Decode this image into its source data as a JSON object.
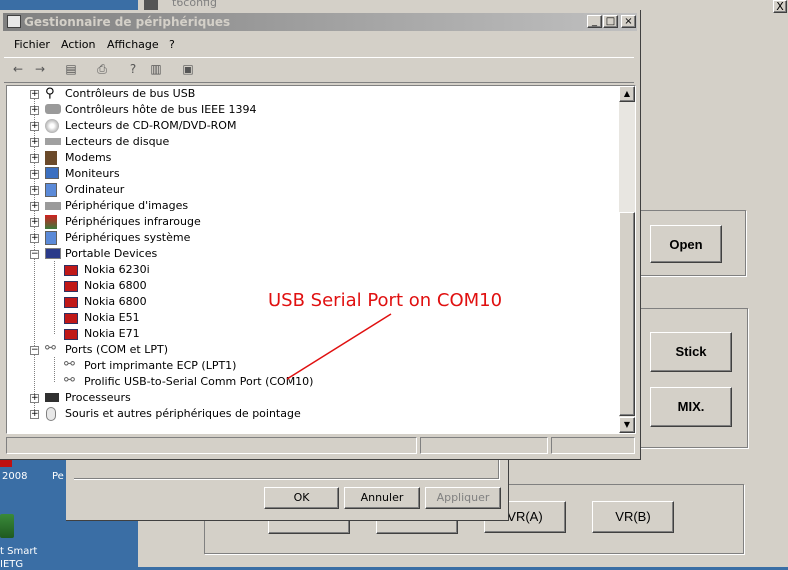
{
  "desktop": {
    "text_2008": "2008",
    "text_pe": "Pe",
    "text_smart": "t Smart",
    "text_ietg": "IETG"
  },
  "background_window": {
    "title": "t6config",
    "close_label": "X",
    "open_button": "Open",
    "stick_button": "Stick",
    "mix_button": "MIX.",
    "vra_button": "VR(A)",
    "vrb_button": "VR(B)"
  },
  "dialog": {
    "ok_label": "OK",
    "cancel_label": "Annuler",
    "apply_label": "Appliquer"
  },
  "window": {
    "title": "Gestionnaire de périphériques",
    "minimize": "_",
    "maximize": "□",
    "close": "×",
    "menu": [
      "Fichier",
      "Action",
      "Affichage",
      "?"
    ]
  },
  "tree": [
    {
      "label": "Contrôleurs de bus USB",
      "icon": "usb-icon"
    },
    {
      "label": "Contrôleurs hôte de bus IEEE 1394",
      "icon": "ieee1394-icon"
    },
    {
      "label": "Lecteurs de CD-ROM/DVD-ROM",
      "icon": "cdrom-icon"
    },
    {
      "label": "Lecteurs de disque",
      "icon": "disk-icon"
    },
    {
      "label": "Modems",
      "icon": "modem-icon"
    },
    {
      "label": "Moniteurs",
      "icon": "monitor-icon"
    },
    {
      "label": "Ordinateur",
      "icon": "computer-icon"
    },
    {
      "label": "Périphérique d'images",
      "icon": "scanner-icon"
    },
    {
      "label": "Périphériques infrarouge",
      "icon": "infrared-icon"
    },
    {
      "label": "Périphériques système",
      "icon": "system-icon"
    },
    {
      "label": "Portable Devices",
      "icon": "portable-devices-icon"
    },
    {
      "label": "Nokia 6230i",
      "icon": "nokia-icon"
    },
    {
      "label": "Nokia 6800",
      "icon": "nokia-icon"
    },
    {
      "label": "Nokia 6800",
      "icon": "nokia-icon"
    },
    {
      "label": "Nokia E51",
      "icon": "nokia-icon"
    },
    {
      "label": "Nokia E71",
      "icon": "nokia-icon"
    },
    {
      "label": "Ports (COM et LPT)",
      "icon": "port-icon"
    },
    {
      "label": "Port imprimante ECP (LPT1)",
      "icon": "port-icon"
    },
    {
      "label": "Prolific USB-to-Serial Comm Port (COM10)",
      "icon": "port-icon"
    },
    {
      "label": "Processeurs",
      "icon": "processor-icon"
    },
    {
      "label": "Souris et autres périphériques de pointage",
      "icon": "mouse-icon"
    }
  ],
  "annotation": "USB Serial Port on COM10",
  "colors": {
    "annotation": "#e01010",
    "title_bar_inactive": "#808080",
    "desktop": "#3a6ea5",
    "face": "#d4d0c8"
  }
}
